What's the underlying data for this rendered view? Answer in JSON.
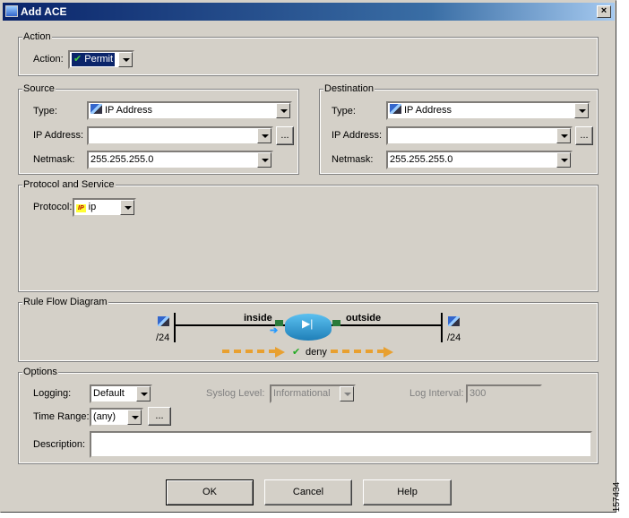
{
  "window": {
    "title": "Add ACE",
    "close": "×"
  },
  "action": {
    "group": "Action",
    "label": "Action:",
    "value": "Permit"
  },
  "source": {
    "group": "Source",
    "type_label": "Type:",
    "type_value": "IP Address",
    "ip_label": "IP Address:",
    "ip_value": "",
    "netmask_label": "Netmask:",
    "netmask_value": "255.255.255.0",
    "browse": "..."
  },
  "destination": {
    "group": "Destination",
    "type_label": "Type:",
    "type_value": "IP Address",
    "ip_label": "IP Address:",
    "ip_value": "",
    "netmask_label": "Netmask:",
    "netmask_value": "255.255.255.0",
    "browse": "..."
  },
  "protocol": {
    "group": "Protocol and Service",
    "label": "Protocol:",
    "icon_text": "IP",
    "value": "ip"
  },
  "diagram": {
    "group": "Rule Flow Diagram",
    "inside": "inside",
    "outside": "outside",
    "left_mask": "/24",
    "right_mask": "/24",
    "result": "deny",
    "arrow_color": "#e8a030"
  },
  "options": {
    "group": "Options",
    "logging_label": "Logging:",
    "logging_value": "Default",
    "syslog_label": "Syslog Level:",
    "syslog_value": "Informational",
    "interval_label": "Log Interval:",
    "interval_value": "300",
    "time_label": "Time Range:",
    "time_value": "(any)",
    "time_browse": "...",
    "desc_label": "Description:",
    "desc_value": ""
  },
  "buttons": {
    "ok": "OK",
    "cancel": "Cancel",
    "help": "Help"
  },
  "figure_id": "157434"
}
